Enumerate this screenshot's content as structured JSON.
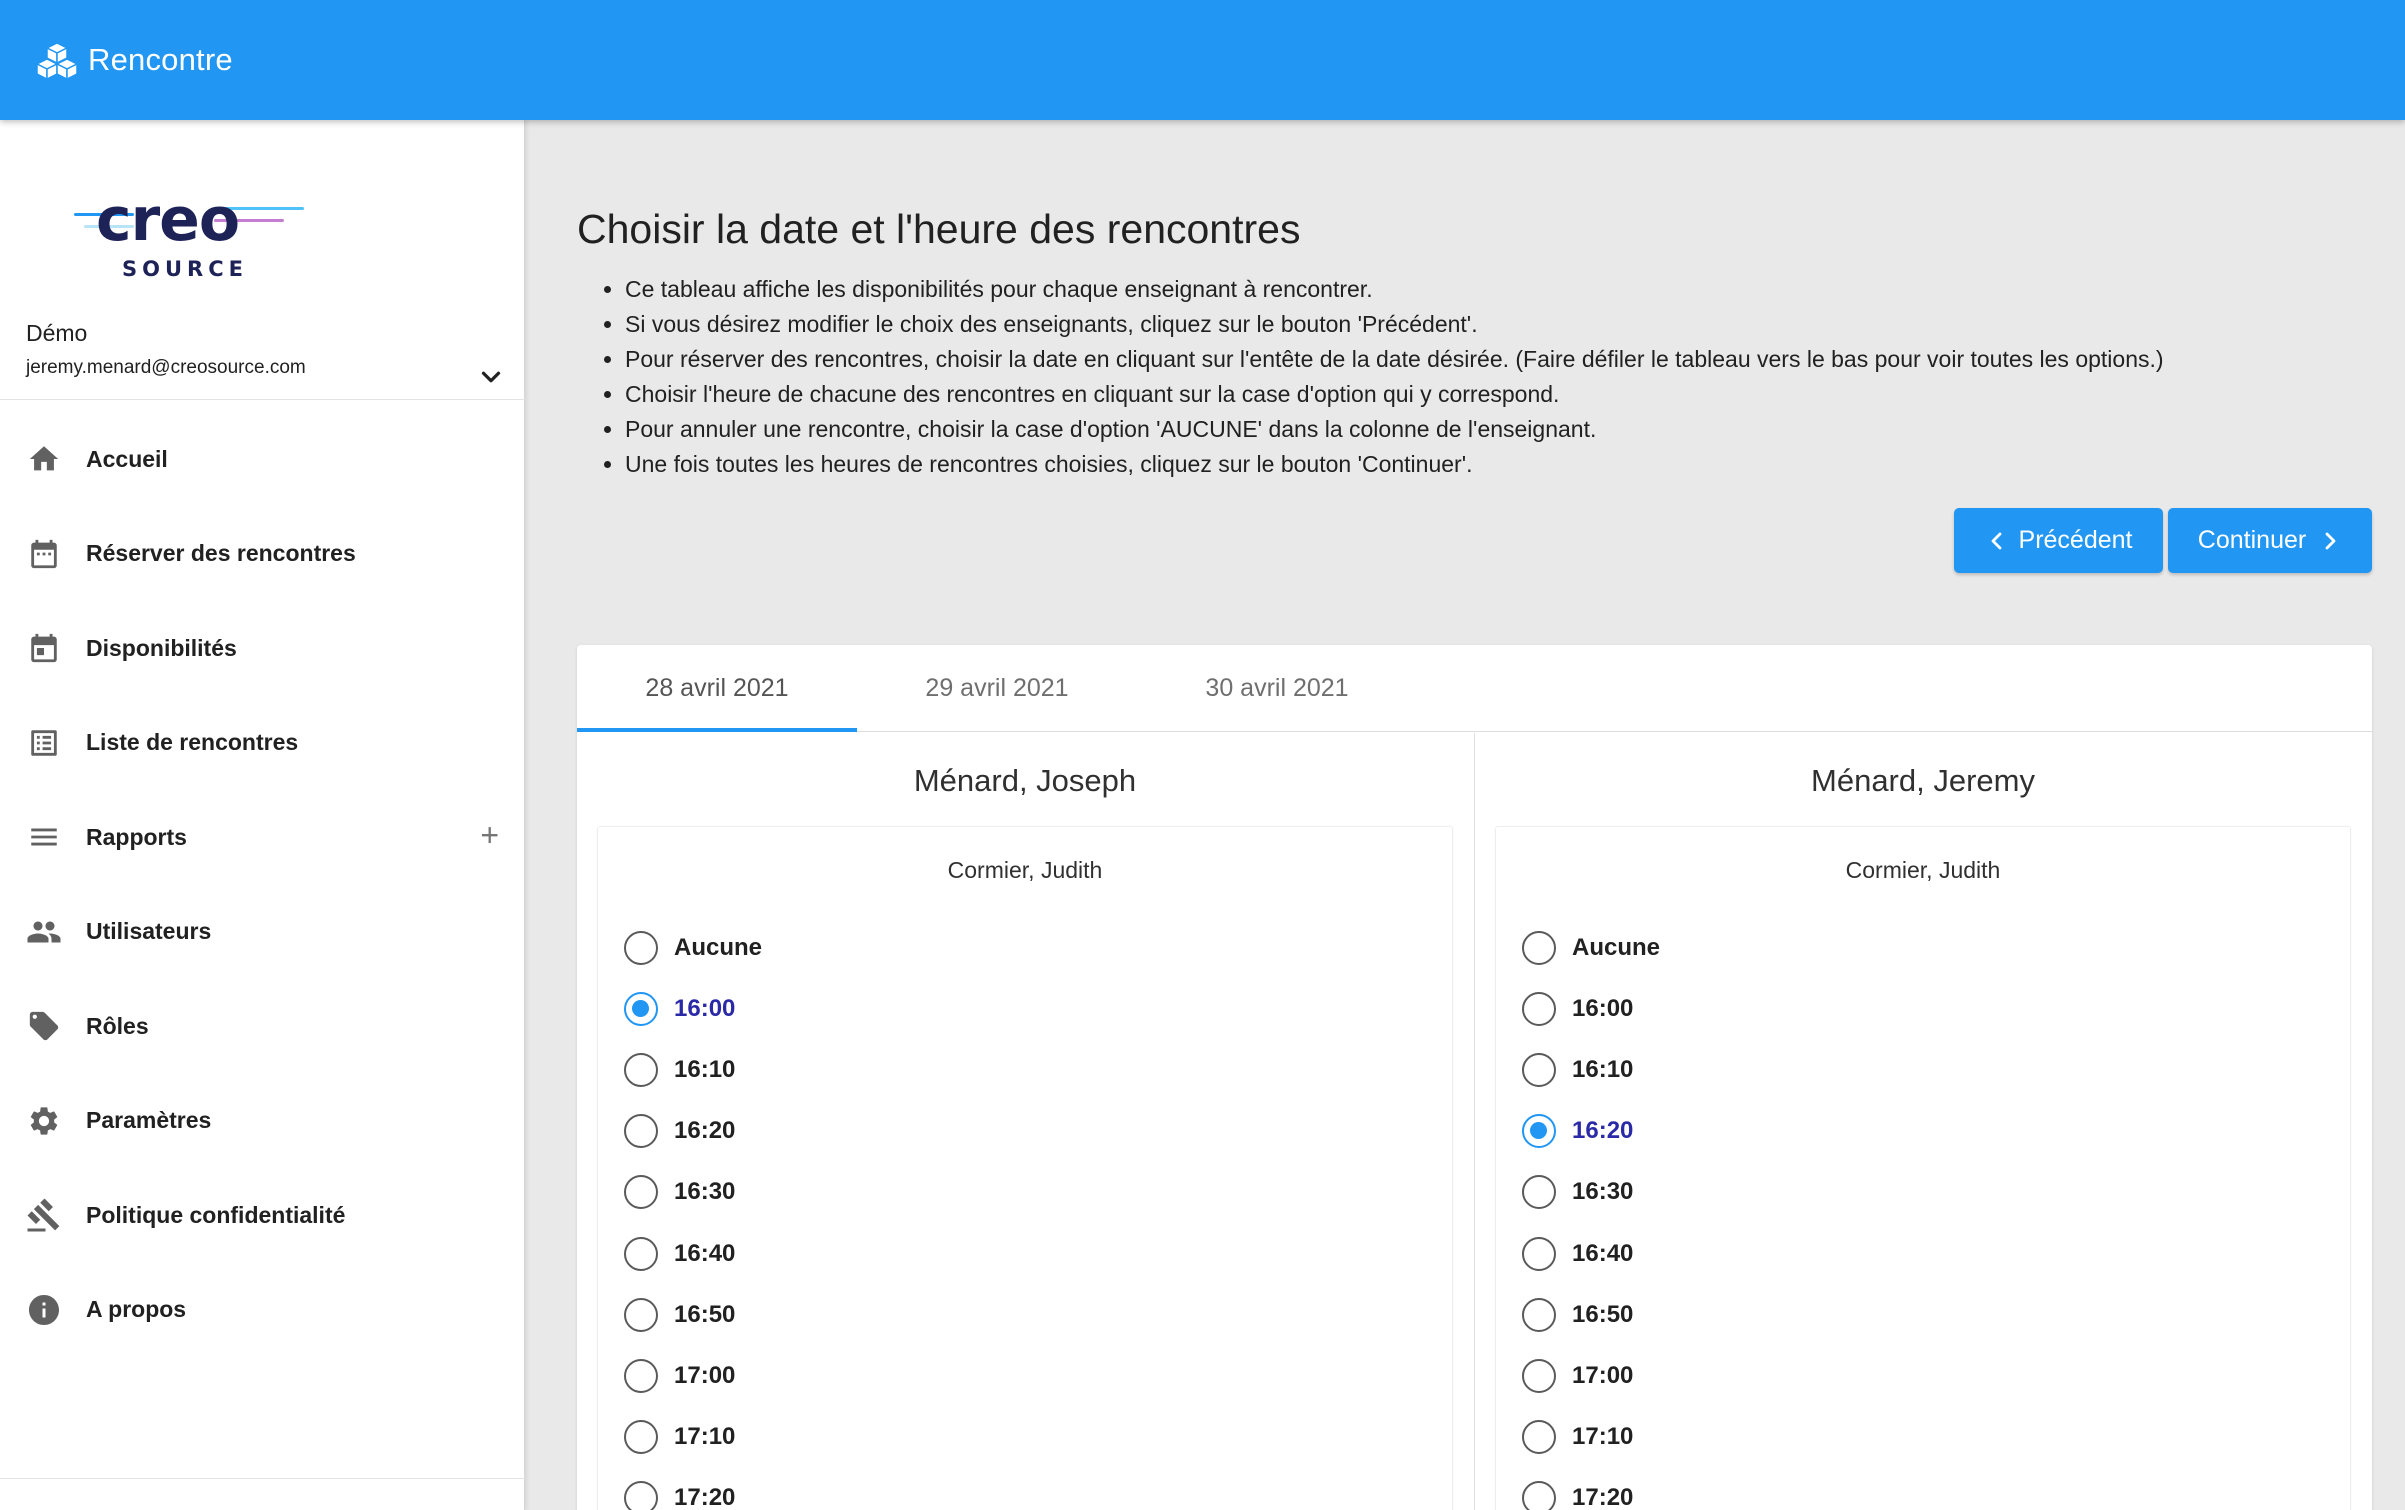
{
  "app": {
    "title": "Rencontre"
  },
  "sidebar": {
    "brand_main": "creo",
    "brand_sub": "SOURCE",
    "user_name": "Démo",
    "user_email": "jeremy.menard@creosource.com",
    "items": [
      {
        "label": "Accueil",
        "icon": "home-icon"
      },
      {
        "label": "Réserver des rencontres",
        "icon": "calendar-icon"
      },
      {
        "label": "Disponibilités",
        "icon": "event-icon"
      },
      {
        "label": "Liste de rencontres",
        "icon": "list-icon"
      },
      {
        "label": "Rapports",
        "icon": "menu-icon",
        "expand": "+"
      },
      {
        "label": "Utilisateurs",
        "icon": "people-icon"
      },
      {
        "label": "Rôles",
        "icon": "tag-icon"
      },
      {
        "label": "Paramètres",
        "icon": "gear-icon"
      },
      {
        "label": "Politique confidentialité",
        "icon": "gavel-icon"
      },
      {
        "label": "A propos",
        "icon": "info-icon"
      }
    ]
  },
  "main": {
    "title": "Choisir la date et l'heure des rencontres",
    "instructions": [
      "Ce tableau affiche les disponibilités pour chaque enseignant à rencontrer.",
      "Si vous désirez modifier le choix des enseignants, cliquez sur le bouton 'Précédent'.",
      "Pour réserver des rencontres, choisir la date en cliquant sur l'entête de la date désirée. (Faire défiler le tableau vers le bas pour voir toutes les options.)",
      "Choisir l'heure de chacune des rencontres en cliquant sur la case d'option qui y correspond.",
      "Pour annuler une rencontre, choisir la case d'option 'AUCUNE' dans la colonne de l'enseignant.",
      "Une fois toutes les heures de rencontres choisies, cliquez sur le bouton 'Continuer'."
    ],
    "buttons": {
      "previous": "Précédent",
      "continue": "Continuer"
    },
    "tabs": [
      "28 avril 2021",
      "29 avril 2021",
      "30 avril 2021"
    ],
    "active_tab": 0,
    "columns": [
      {
        "teacher": "Ménard, Joseph",
        "student": "Cormier, Judith",
        "options": [
          "Aucune",
          "16:00",
          "16:10",
          "16:20",
          "16:30",
          "16:40",
          "16:50",
          "17:00",
          "17:10",
          "17:20"
        ],
        "selected": "16:00"
      },
      {
        "teacher": "Ménard, Jeremy",
        "student": "Cormier, Judith",
        "options": [
          "Aucune",
          "16:00",
          "16:10",
          "16:20",
          "16:30",
          "16:40",
          "16:50",
          "17:00",
          "17:10",
          "17:20"
        ],
        "selected": "16:20"
      }
    ]
  },
  "colors": {
    "primary": "#2196f3",
    "selected_text": "#2a2aa8"
  }
}
